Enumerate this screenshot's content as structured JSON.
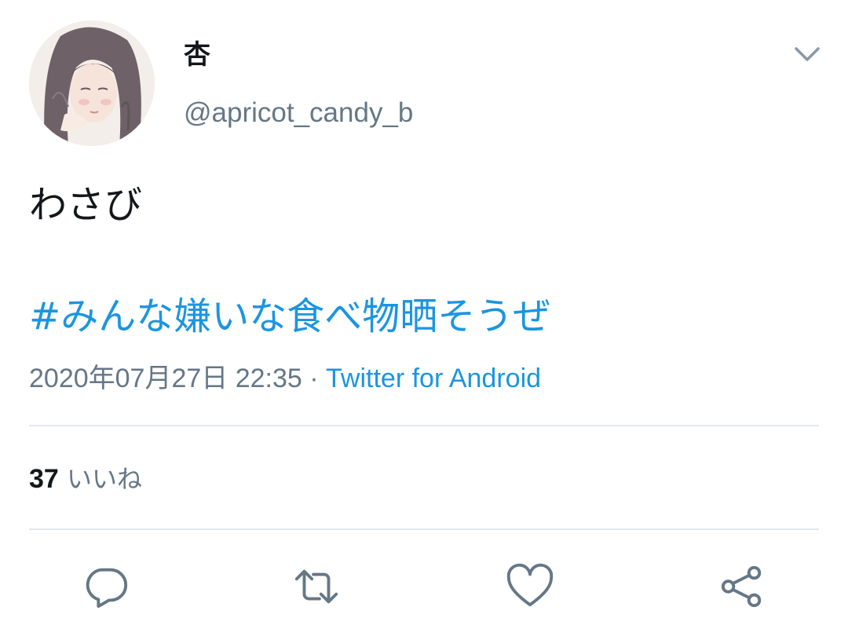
{
  "tweet": {
    "author": {
      "display_name": "杏",
      "handle": "@apricot_candy_b"
    },
    "text": "わさび",
    "hashtag": "#みんな嫌いな食べ物晒そうぜ",
    "timestamp": "2020年07月27日 22:35",
    "separator": " · ",
    "source": "Twitter for Android",
    "likes": {
      "count": "37",
      "label": "いいね"
    }
  },
  "icons": {
    "more": "chevron-down-icon",
    "reply": "reply-icon",
    "retweet": "retweet-icon",
    "like": "heart-icon",
    "share": "share-icon"
  },
  "colors": {
    "link": "#1b95e0",
    "secondary_text": "#657786",
    "primary_text": "#14171a",
    "divider": "#e1e8ed"
  }
}
